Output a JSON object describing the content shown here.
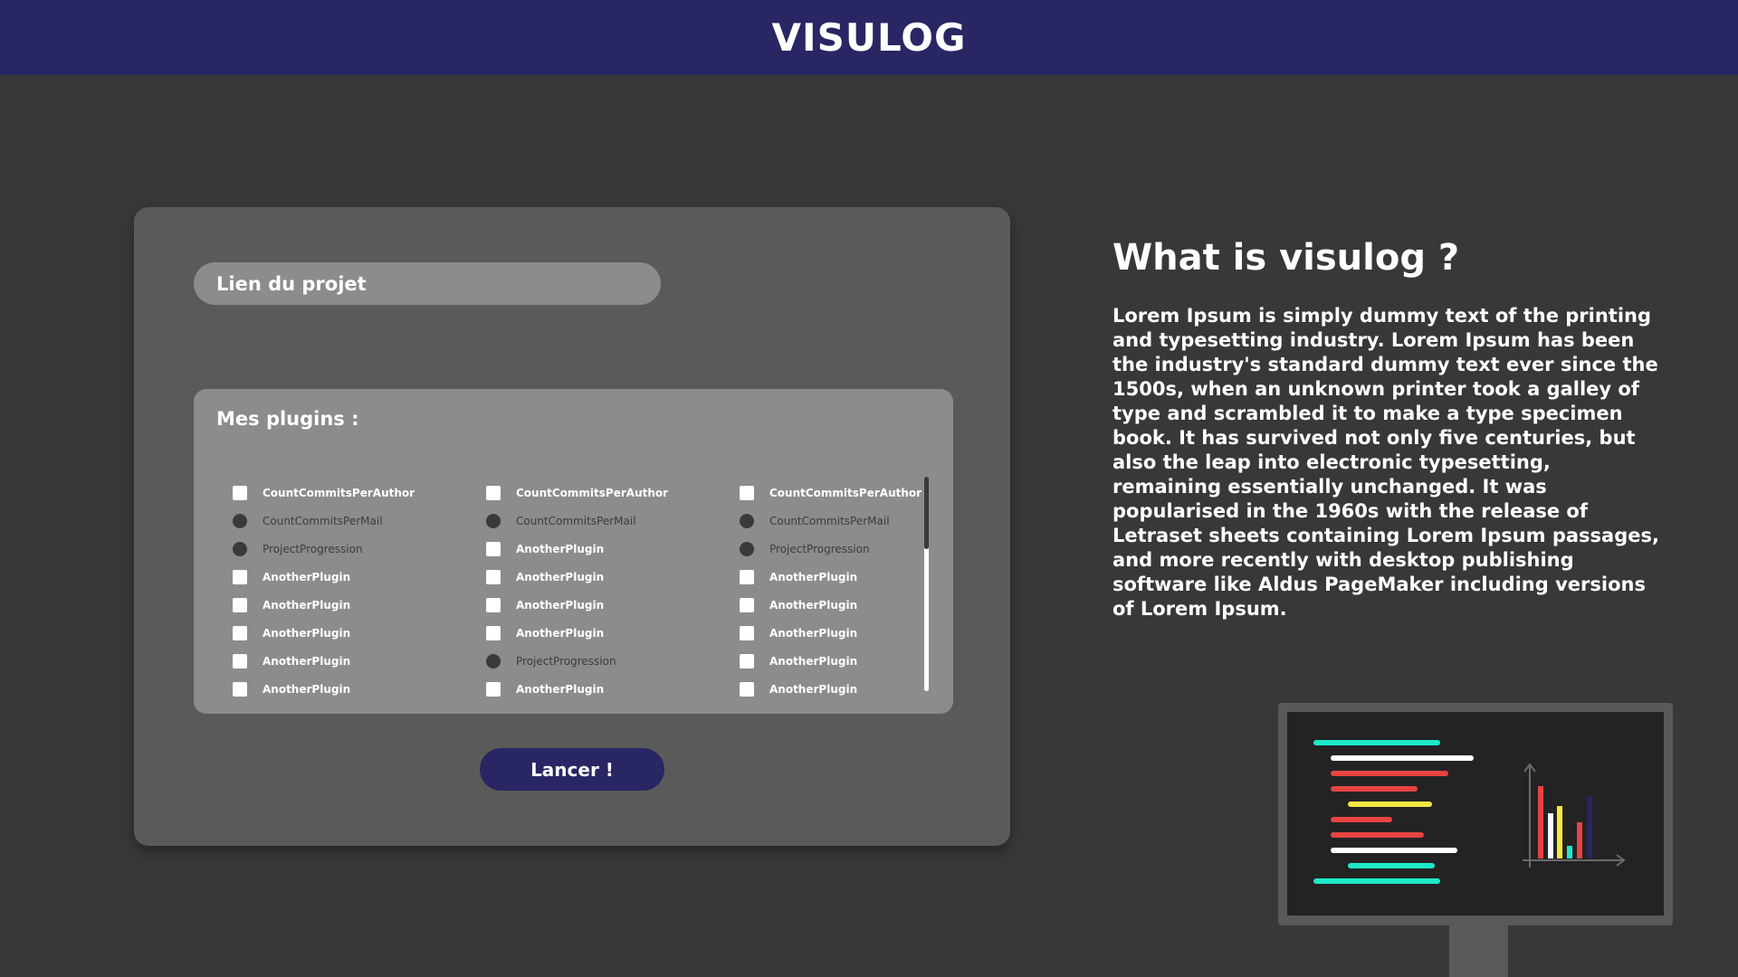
{
  "header": {
    "title": "VISULOG"
  },
  "form": {
    "project_link_placeholder": "Lien du projet",
    "plugins_title": "Mes plugins :",
    "launch_label": "Lancer !"
  },
  "plugins": {
    "columns": [
      [
        {
          "label": "CountCommitsPerAuthor",
          "state": "unchecked"
        },
        {
          "label": "CountCommitsPerMail",
          "state": "selected"
        },
        {
          "label": "ProjectProgression",
          "state": "selected"
        },
        {
          "label": "AnotherPlugin",
          "state": "unchecked"
        },
        {
          "label": "AnotherPlugin",
          "state": "unchecked"
        },
        {
          "label": "AnotherPlugin",
          "state": "unchecked"
        },
        {
          "label": "AnotherPlugin",
          "state": "unchecked"
        },
        {
          "label": "AnotherPlugin",
          "state": "unchecked"
        }
      ],
      [
        {
          "label": "CountCommitsPerAuthor",
          "state": "unchecked"
        },
        {
          "label": "CountCommitsPerMail",
          "state": "selected"
        },
        {
          "label": "AnotherPlugin",
          "state": "unchecked"
        },
        {
          "label": "AnotherPlugin",
          "state": "unchecked"
        },
        {
          "label": "AnotherPlugin",
          "state": "unchecked"
        },
        {
          "label": "AnotherPlugin",
          "state": "unchecked"
        },
        {
          "label": "ProjectProgression",
          "state": "selected"
        },
        {
          "label": "AnotherPlugin",
          "state": "unchecked"
        }
      ],
      [
        {
          "label": "CountCommitsPerAuthor",
          "state": "unchecked"
        },
        {
          "label": "CountCommitsPerMail",
          "state": "selected"
        },
        {
          "label": "ProjectProgression",
          "state": "selected"
        },
        {
          "label": "AnotherPlugin",
          "state": "unchecked"
        },
        {
          "label": "AnotherPlugin",
          "state": "unchecked"
        },
        {
          "label": "AnotherPlugin",
          "state": "unchecked"
        },
        {
          "label": "AnotherPlugin",
          "state": "unchecked"
        },
        {
          "label": "AnotherPlugin",
          "state": "unchecked"
        }
      ]
    ]
  },
  "info": {
    "title": "What is visulog ?",
    "text": "Lorem Ipsum is simply dummy text of the printing and typesetting industry. Lorem Ipsum has been the industry's standard dummy text ever since the 1500s, when an unknown printer took a galley of type and scrambled it to make a type specimen book. It has survived not only five centuries, but also the leap into electronic typesetting, remaining essentially unchanged. It was popularised in the 1960s with the release of Letraset sheets containing Lorem Ipsum passages, and more recently with desktop publishing software like Aldus PageMaker including versions of Lorem Ipsum."
  },
  "illustration": {
    "name": "monitor-code-chart-illustration",
    "colors": {
      "teal": "#1de9c9",
      "white": "#ffffff",
      "red": "#e84343",
      "yellow": "#f4e845",
      "navy": "#282663",
      "axis": "#6a6a6a"
    }
  },
  "theme": {
    "header_bg": "#282663",
    "page_bg": "#383838",
    "panel_bg": "#5a5a5a",
    "field_bg": "#8c8c8c",
    "button_bg": "#282663"
  }
}
